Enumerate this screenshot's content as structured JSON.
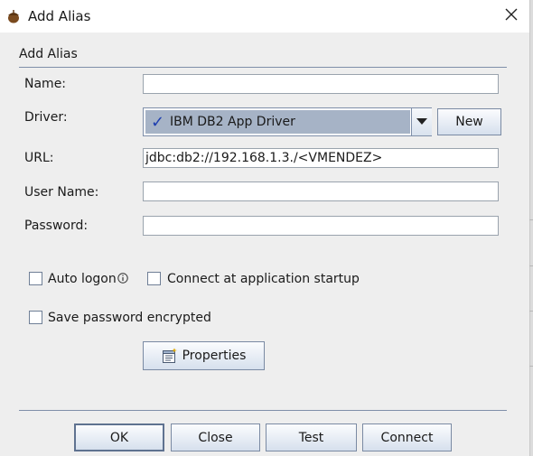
{
  "window": {
    "title": "Add Alias"
  },
  "section": {
    "title": "Add Alias"
  },
  "form": {
    "name_label": "Name:",
    "name_value": "",
    "driver_label": "Driver:",
    "driver_selected": "IBM DB2 App Driver",
    "new_button": "New",
    "url_label": "URL:",
    "url_value": "jdbc:db2://192.168.1.3./<VMENDEZ>",
    "username_label": "User Name:",
    "username_value": "",
    "password_label": "Password:",
    "password_value": ""
  },
  "options": {
    "auto_logon": {
      "label": "Auto logon",
      "checked": false
    },
    "connect_startup": {
      "label": "Connect at application startup",
      "checked": false
    },
    "save_password": {
      "label": "Save password encrypted",
      "checked": false
    },
    "properties_button": "Properties"
  },
  "footer": {
    "ok": "OK",
    "close": "Close",
    "test": "Test",
    "connect": "Connect"
  },
  "icons": {
    "app": "acorn-icon",
    "close": "close-icon",
    "check": "checkmark-icon",
    "dropdown": "triangle-down-icon",
    "info": "info-icon",
    "properties": "properties-icon"
  },
  "colors": {
    "selection": "#a6b3c6",
    "check": "#1f3fb0",
    "rule": "#7f8fa9"
  }
}
